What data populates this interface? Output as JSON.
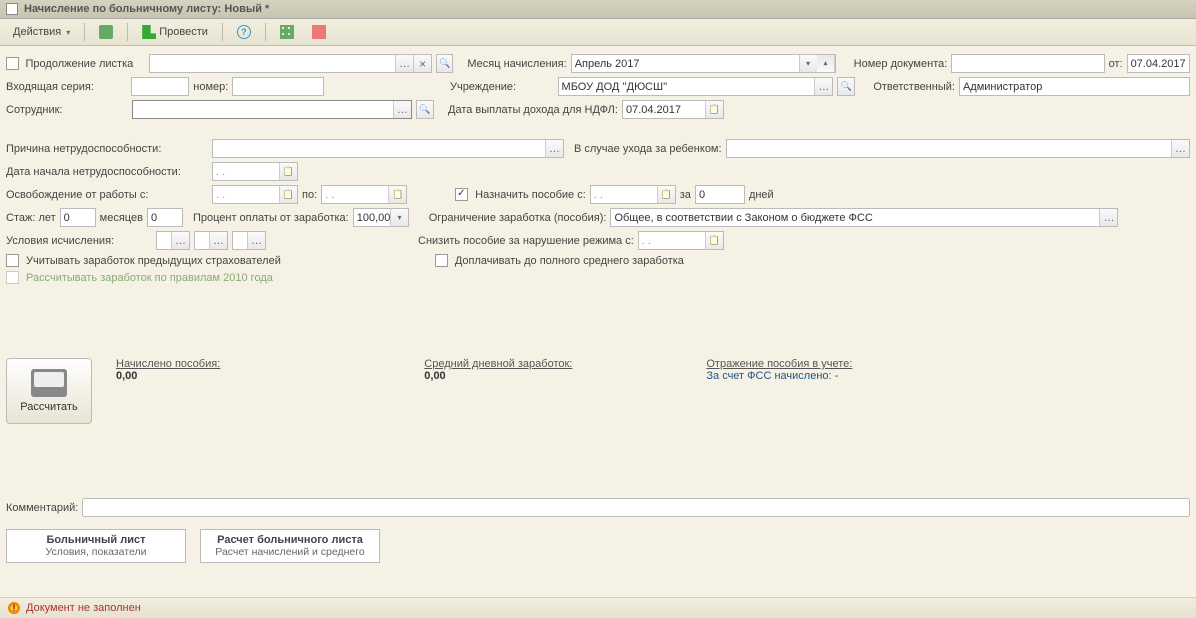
{
  "title": "Начисление по больничному листу: Новый *",
  "toolbar": {
    "actions": "Действия",
    "post": "Провести"
  },
  "header": {
    "continuation": "Продолжение листка",
    "incoming_series": "Входящая серия:",
    "number": "номер:",
    "employee": "Сотрудник:",
    "accrual_month_label": "Месяц начисления:",
    "accrual_month": "Апрель 2017",
    "institution_label": "Учреждение:",
    "institution": "МБОУ ДОД ''ДЮСШ''",
    "ndfl_date_label": "Дата выплаты дохода для НДФЛ:",
    "ndfl_date": "07.04.2017",
    "docnum_label": "Номер документа:",
    "date_from_label": "от:",
    "date_from": "07.04.2017",
    "responsible_label": "Ответственный:",
    "responsible": "Администратор"
  },
  "block": {
    "cause_label": "Причина нетрудоспособности:",
    "child_care_label": "В случае ухода за ребенком:",
    "start_label": "Дата начала нетрудоспособности:",
    "date_dots": ". .",
    "release_label": "Освобождение от работы с:",
    "po": "по:",
    "assign_label": "Назначить пособие с:",
    "za": "за",
    "days_zero": "0",
    "days_word": "дней",
    "experience_years": "Стаж: лет",
    "zero": "0",
    "months": "месяцев",
    "percent_label": "Процент оплаты от заработка:",
    "percent_val": "100,00",
    "limit_label": "Ограничение заработка (пособия):",
    "limit_val": "Общее, в соответствии с Законом о бюджете ФСС",
    "calc_cond_label": "Условия исчисления:",
    "reduce_label": "Снизить пособие за нарушение режима с:",
    "prev_insurers": "Учитывать заработок предыдущих страхователей",
    "full_avg": "Доплачивать до полного среднего заработка",
    "rules2010": "Рассчитывать заработок по правилам 2010 года"
  },
  "summary": {
    "calc_btn": "Рассчитать",
    "accrued_label": "Начислено пособия:",
    "accrued_val": "0,00",
    "avg_label": "Средний дневной заработок:",
    "avg_val": "0,00",
    "reflect_label": "Отражение пособия в учете:",
    "fss_link": "За счет ФСС начислено: -"
  },
  "comment_label": "Комментарий:",
  "tabs": {
    "t1a": "Больничный лист",
    "t1b": "Условия, показатели",
    "t2a": "Расчет больничного листа",
    "t2b": "Расчет начислений и среднего"
  },
  "status": "Документ не заполнен"
}
